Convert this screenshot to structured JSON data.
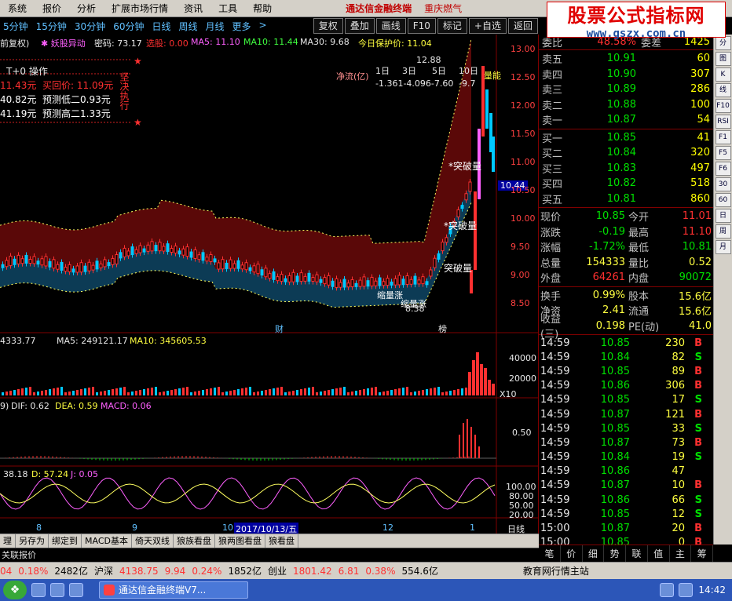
{
  "menubar": {
    "items": [
      "系统",
      "报价",
      "分析",
      "扩展市场行情",
      "资讯",
      "工具",
      "帮助"
    ],
    "brand": "通达信金融终端",
    "stock_name": "重庆燃气"
  },
  "watermark": {
    "title": "股票公式指标网",
    "url": "www.gszx.com.cn"
  },
  "toolbar2": {
    "buttons": [
      "复权",
      "叠加",
      "画线",
      "F10",
      "标记",
      "+自选",
      "返回"
    ]
  },
  "chart_header": {
    "restore": "前复权)",
    "indicator_name": "妖股异动",
    "password_label": "密码: 73.17",
    "select_label": "选股: 0.00",
    "ma5": "MA5: 11.10",
    "ma10": "MA10: 11.44",
    "ma30": "MA30: 9.68",
    "protect_price": "今日保护价: 11.04"
  },
  "periods": [
    "5分钟",
    "15分钟",
    "30分钟",
    "60分钟",
    "日线",
    "周线",
    "月线",
    "更多",
    ">"
  ],
  "t0_box": {
    "title": "T+0 操作",
    "row1_left": "11.43元",
    "row1_right": "买回价: 11.09元",
    "row2_left": "40.82元",
    "row2_right": "预测低二0.93元",
    "row3_left": "41.19元",
    "row3_right": "预测高二1.33元",
    "side_text": "坚决执行"
  },
  "net_flow": {
    "label": "净流(亿)",
    "tabs": [
      "1日",
      "3日",
      "5日",
      "10日"
    ],
    "values": "-1.361-4.096-7.60",
    "tail": "-9.7",
    "extra": "量能"
  },
  "annotations": {
    "peak": "12.88",
    "low": "8.38",
    "break1": "*突破量",
    "break2": "*突破量",
    "break3": "突破量",
    "shrink1": "缩量涨",
    "shrink2": "缩量涨",
    "cai": "财",
    "bang": "榜",
    "current_price_tag": "10.44"
  },
  "price_axis": [
    "13.00",
    "12.50",
    "12.00",
    "11.50",
    "11.00",
    "10.50",
    "10.00",
    "9.50",
    "9.00",
    "8.50"
  ],
  "volume_header": {
    "vol": "4333.77",
    "ma5": "MA5: 249121.17",
    "ma10": "MA10: 345605.53"
  },
  "volume_axis": [
    "40000",
    "20000",
    "X10"
  ],
  "macd_header": {
    "params": "9)",
    "dif": "DIF: 0.62",
    "dea": "DEA: 0.59",
    "macd": "MACD: 0.06"
  },
  "macd_axis": [
    "0.50"
  ],
  "kdj_header": {
    "k": "38.18",
    "d": "D: 57.24",
    "j": "J: 0.05"
  },
  "kdj_axis": [
    "100.00",
    "80.00",
    "50.00",
    "20.00"
  ],
  "date_axis": {
    "labels": [
      "8",
      "9",
      "10",
      "12",
      "1"
    ],
    "highlight": "2017/10/13/五",
    "period_label": "日线"
  },
  "bottom_tabs": [
    "理",
    "另存为",
    "绑定到",
    "MACD基本",
    "倚天双线",
    "狼族看盘",
    "狼两图看盘",
    "狼看盘"
  ],
  "link_row": "关联报价",
  "quote": {
    "committee": {
      "label": "委比",
      "value": "48.58%",
      "diff_label": "委差",
      "diff": "1425"
    },
    "asks": [
      {
        "label": "卖五",
        "price": "10.91",
        "vol": "60"
      },
      {
        "label": "卖四",
        "price": "10.90",
        "vol": "307"
      },
      {
        "label": "卖三",
        "price": "10.89",
        "vol": "286"
      },
      {
        "label": "卖二",
        "price": "10.88",
        "vol": "100"
      },
      {
        "label": "卖一",
        "price": "10.87",
        "vol": "54"
      }
    ],
    "bids": [
      {
        "label": "买一",
        "price": "10.85",
        "vol": "41"
      },
      {
        "label": "买二",
        "price": "10.84",
        "vol": "320"
      },
      {
        "label": "买三",
        "price": "10.83",
        "vol": "497"
      },
      {
        "label": "买四",
        "price": "10.82",
        "vol": "518"
      },
      {
        "label": "买五",
        "price": "10.81",
        "vol": "860"
      }
    ],
    "stats": [
      {
        "k1": "现价",
        "v1": "10.85",
        "c1": "green",
        "k2": "今开",
        "v2": "11.01",
        "c2": "red"
      },
      {
        "k1": "涨跌",
        "v1": "-0.19",
        "c1": "green",
        "k2": "最高",
        "v2": "11.10",
        "c2": "red"
      },
      {
        "k1": "涨幅",
        "v1": "-1.72%",
        "c1": "green",
        "k2": "最低",
        "v2": "10.81",
        "c2": "green"
      },
      {
        "k1": "总量",
        "v1": "154333",
        "c1": "yellow",
        "k2": "量比",
        "v2": "0.52",
        "c2": "yellow"
      },
      {
        "k1": "外盘",
        "v1": "64261",
        "c1": "red",
        "k2": "内盘",
        "v2": "90072",
        "c2": "green"
      }
    ],
    "stats2": [
      {
        "k1": "换手",
        "v1": "0.99%",
        "k2": "股本",
        "v2": "15.6亿"
      },
      {
        "k1": "净资",
        "v1": "2.41",
        "k2": "流通",
        "v2": "15.6亿"
      },
      {
        "k1": "收益(三)",
        "v1": "0.198",
        "k2": "PE(动)",
        "v2": "41.0"
      }
    ],
    "ticks": [
      {
        "t": "14:59",
        "p": "10.85",
        "pc": "green",
        "v": "230",
        "bs": "B"
      },
      {
        "t": "14:59",
        "p": "10.84",
        "pc": "green",
        "v": "82",
        "bs": "S"
      },
      {
        "t": "14:59",
        "p": "10.85",
        "pc": "green",
        "v": "89",
        "bs": "B"
      },
      {
        "t": "14:59",
        "p": "10.86",
        "pc": "green",
        "v": "306",
        "bs": "B"
      },
      {
        "t": "14:59",
        "p": "10.85",
        "pc": "green",
        "v": "17",
        "bs": "S"
      },
      {
        "t": "14:59",
        "p": "10.87",
        "pc": "green",
        "v": "121",
        "bs": "B"
      },
      {
        "t": "14:59",
        "p": "10.85",
        "pc": "green",
        "v": "33",
        "bs": "S"
      },
      {
        "t": "14:59",
        "p": "10.87",
        "pc": "green",
        "v": "73",
        "bs": "B"
      },
      {
        "t": "14:59",
        "p": "10.84",
        "pc": "green",
        "v": "19",
        "bs": "S"
      },
      {
        "t": "14:59",
        "p": "10.86",
        "pc": "green",
        "v": "47",
        "bs": ""
      },
      {
        "t": "14:59",
        "p": "10.87",
        "pc": "green",
        "v": "10",
        "bs": "B"
      },
      {
        "t": "14:59",
        "p": "10.86",
        "pc": "green",
        "v": "66",
        "bs": "S"
      },
      {
        "t": "14:59",
        "p": "10.85",
        "pc": "green",
        "v": "12",
        "bs": "S"
      },
      {
        "t": "15:00",
        "p": "10.87",
        "pc": "green",
        "v": "20",
        "bs": "B"
      },
      {
        "t": "15:00",
        "p": "10.85",
        "pc": "green",
        "v": "0",
        "bs": "B"
      }
    ],
    "tabs": [
      "笔",
      "价",
      "细",
      "势",
      "联",
      "值",
      "主",
      "筹"
    ]
  },
  "side_bar": [
    "分",
    "图",
    "K",
    "线",
    "F10",
    "RSI",
    "F1",
    "F5",
    "F6",
    "30",
    "60",
    "日",
    "周",
    "月"
  ],
  "ticker": {
    "a": "04",
    "a_pct": "0.18%",
    "a_amt": "2482亿",
    "sz_name": "沪深",
    "sz_val": "4138.75",
    "sz_chg": "9.94",
    "sz_pct": "0.24%",
    "sz_amt": "1852亿",
    "cy_name": "创业",
    "cy_val": "1801.42",
    "cy_chg": "6.81",
    "cy_pct": "0.38%",
    "cy_amt": "554.6亿",
    "site": "教育网行情主站"
  },
  "taskbar": {
    "task": "通达信金融终端V7...",
    "clock": "14:42"
  },
  "colors": {
    "up": "#ff3030",
    "down": "#00e0ff",
    "band_upper": "#7a0a0a",
    "band_lower": "#0f4a66",
    "panel_border": "#800000"
  }
}
